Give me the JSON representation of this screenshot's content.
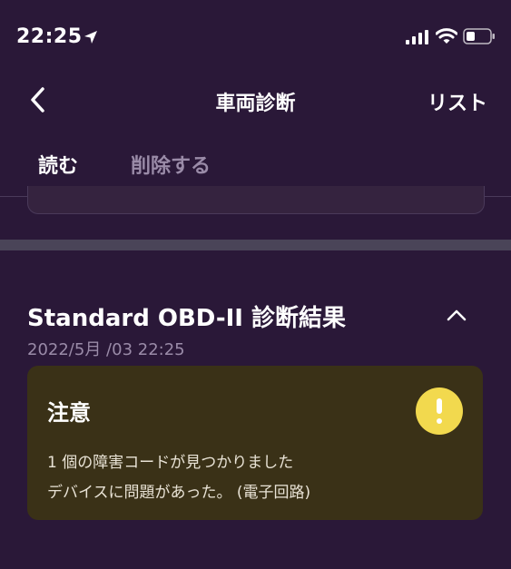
{
  "status_bar": {
    "time": "22:25"
  },
  "nav": {
    "title": "車両診断",
    "right_label": "リスト"
  },
  "tabs": [
    {
      "label": "読む",
      "active": true
    },
    {
      "label": "削除する",
      "active": false
    }
  ],
  "result": {
    "title": "Standard OBD-II 診断結果",
    "date": "2022/5月 /03 22:25"
  },
  "alert": {
    "title": "注意",
    "line1": "1 個の障害コードが見つかりました",
    "line2": "デバイスに問題があった。 (電子回路)",
    "icon": "warning-icon",
    "icon_color": "#f2d94e"
  },
  "colors": {
    "background": "#2a1838",
    "alert_card": "#3a3117",
    "muted_text": "#9a8ba8"
  }
}
